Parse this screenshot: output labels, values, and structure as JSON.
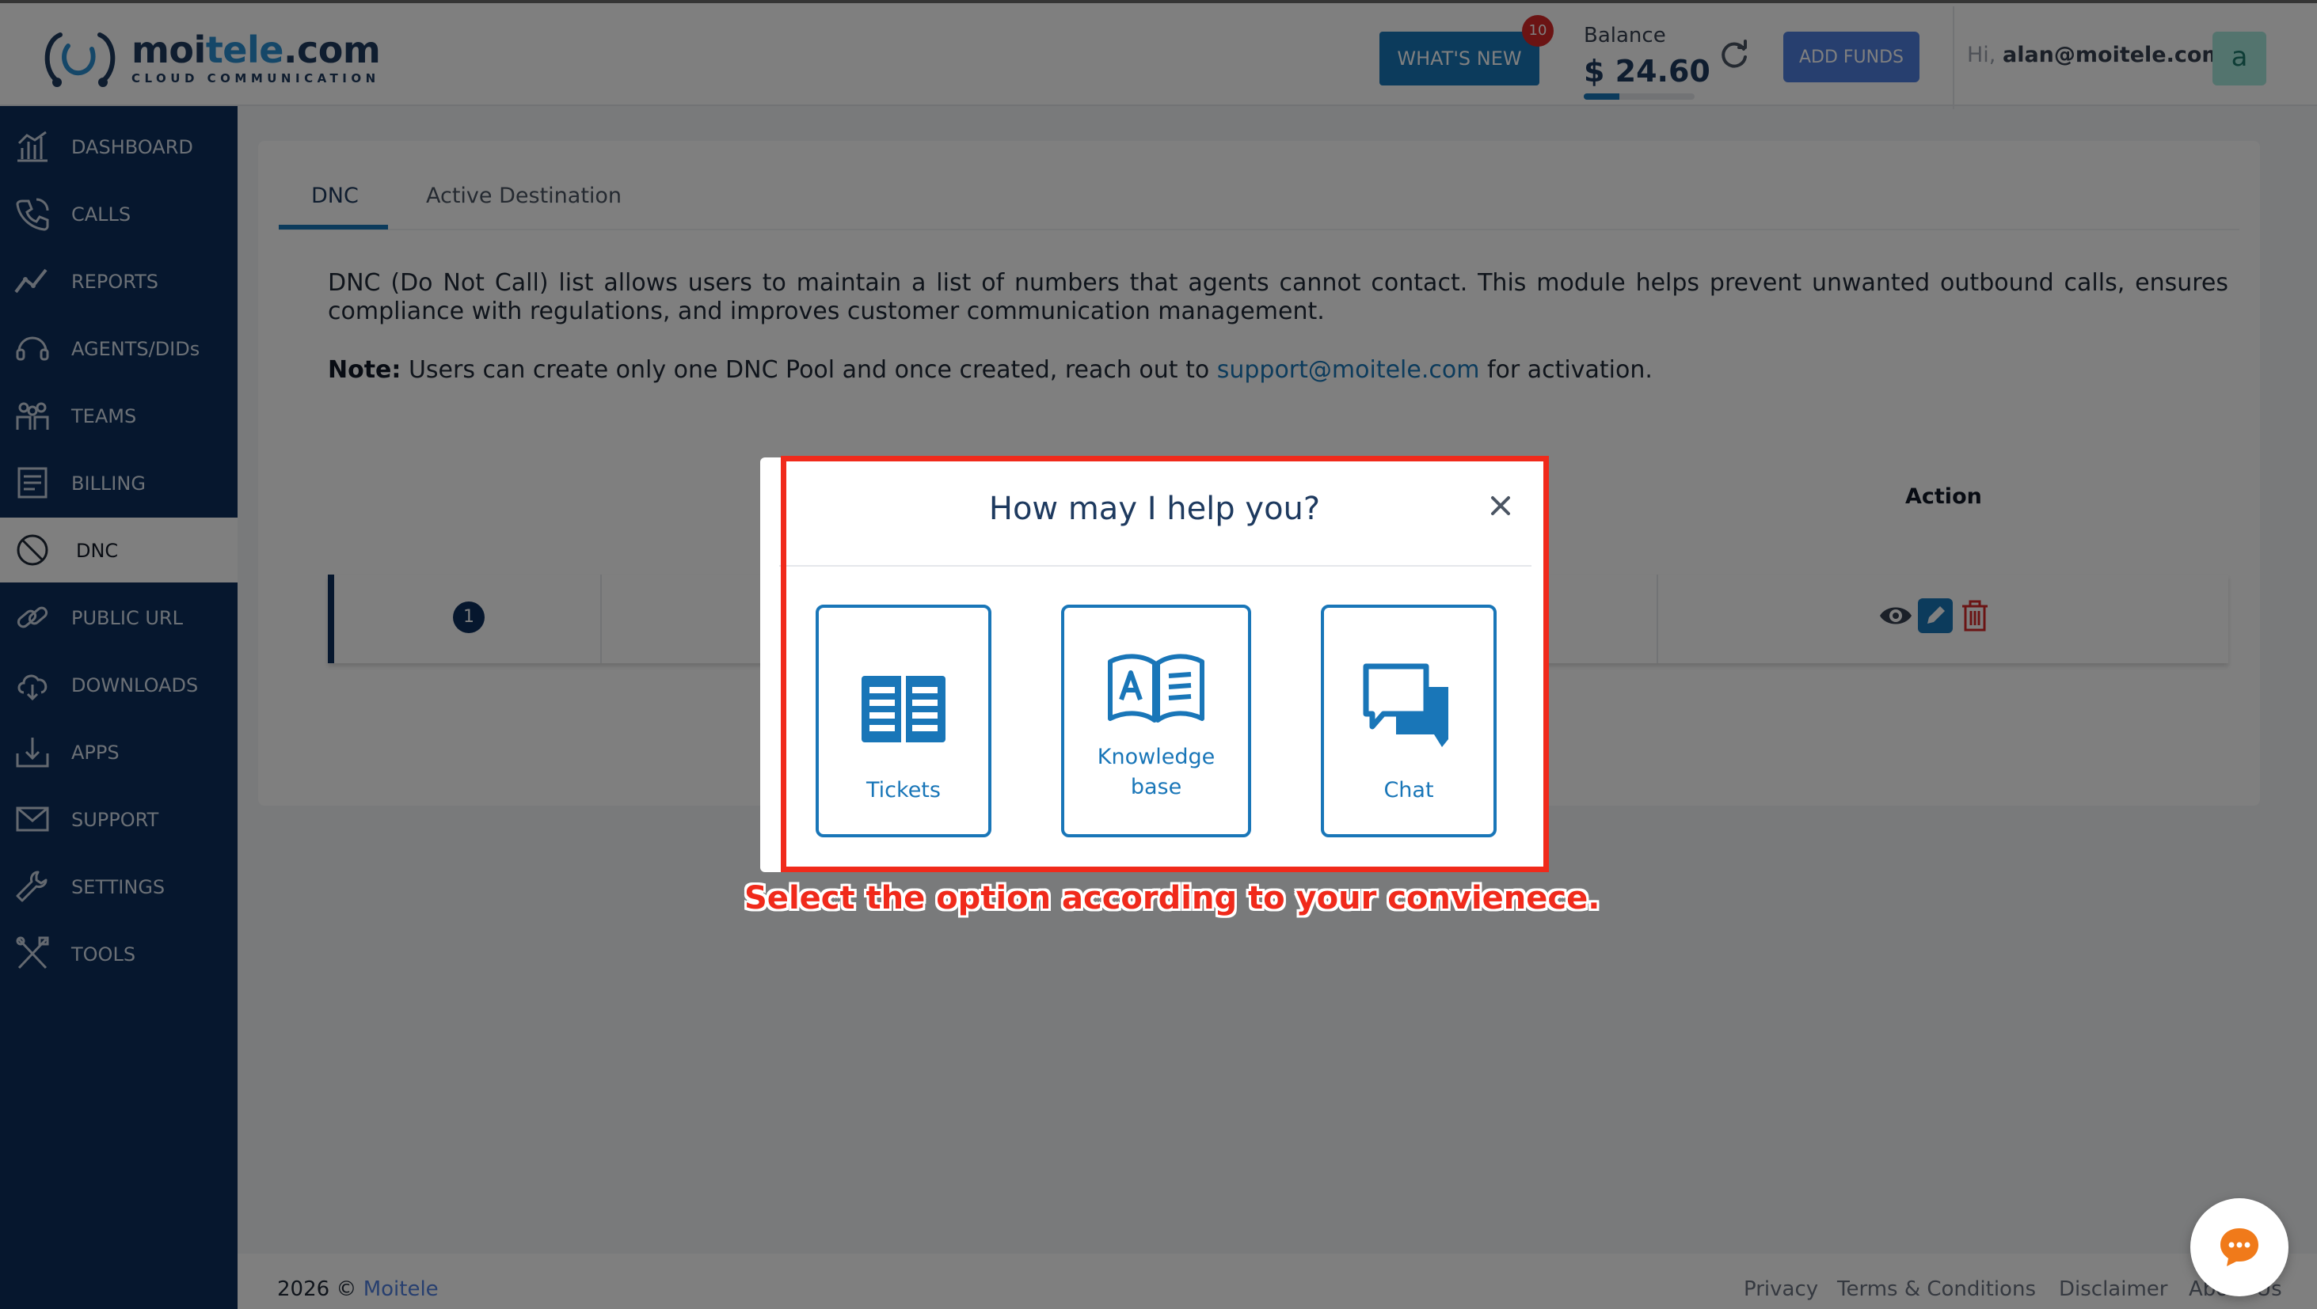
{
  "header": {
    "logo_name_prefix": "moi",
    "logo_name_accent": "tele",
    "logo_name_suffix": ".com",
    "logo_subtitle": "CLOUD COMMUNICATION",
    "whats_new_label": "WHAT'S NEW",
    "whats_new_badge": "10",
    "balance_label": "Balance",
    "balance_value": "$ 24.60",
    "balance_progress": 0.32,
    "add_funds_label": "ADD FUNDS",
    "greeting_prefix": "Hi,",
    "user_email": "alan@moitele.com",
    "avatar_letter": "a"
  },
  "sidebar": {
    "items": [
      {
        "label": "DASHBOARD",
        "icon": "dashboard-icon"
      },
      {
        "label": "CALLS",
        "icon": "phone-icon"
      },
      {
        "label": "REPORTS",
        "icon": "chart-line-icon"
      },
      {
        "label": "AGENTS/DIDs",
        "icon": "headset-icon"
      },
      {
        "label": "TEAMS",
        "icon": "team-icon"
      },
      {
        "label": "BILLING",
        "icon": "billing-icon"
      },
      {
        "label": "DNC",
        "icon": "block-icon",
        "active": true
      },
      {
        "label": "PUBLIC URL",
        "icon": "link-icon"
      },
      {
        "label": "DOWNLOADS",
        "icon": "cloud-download-icon"
      },
      {
        "label": "APPS",
        "icon": "apps-download-icon"
      },
      {
        "label": "SUPPORT",
        "icon": "mail-icon"
      },
      {
        "label": "SETTINGS",
        "icon": "wrench-icon"
      },
      {
        "label": "TOOLS",
        "icon": "tools-icon"
      }
    ]
  },
  "main": {
    "tabs": [
      {
        "label": "DNC",
        "active": true
      },
      {
        "label": "Active Destination",
        "active": false
      }
    ],
    "description": "DNC (Do Not Call) list allows users to maintain a list of numbers that agents cannot contact. This module helps prevent unwanted outbound calls, ensures compliance with regulations, and improves customer communication management.",
    "note_label": "Note:",
    "note_text_before": " Users can create only one DNC Pool and once created, reach out to ",
    "note_link": "support@moitele.com",
    "note_text_after": " for activation.",
    "table": {
      "action_header": "Action",
      "rows": [
        {
          "index": "1"
        }
      ],
      "action_icons": [
        "eye-icon",
        "pencil-icon",
        "trash-icon"
      ]
    }
  },
  "modal": {
    "title": "How may I help you?",
    "options": [
      {
        "label": "Tickets",
        "icon": "tickets-icon"
      },
      {
        "label": "Knowledge base",
        "icon": "knowledge-base-icon"
      },
      {
        "label": "Chat",
        "icon": "chat-icon"
      }
    ]
  },
  "annotation": {
    "text": "Select the option according to your convienece."
  },
  "footer": {
    "year": "2026 ©",
    "brand": "Moitele",
    "links": [
      "Privacy",
      "Terms & Conditions",
      "Disclaimer",
      "About Us"
    ]
  },
  "colors": {
    "sidebar_bg": "#0d2f5c",
    "primary": "#1976b8",
    "add_funds": "#4f7fde",
    "badge": "#d62828",
    "highlight": "#f02a1b",
    "chat_fab_accent": "#f07a1a"
  }
}
